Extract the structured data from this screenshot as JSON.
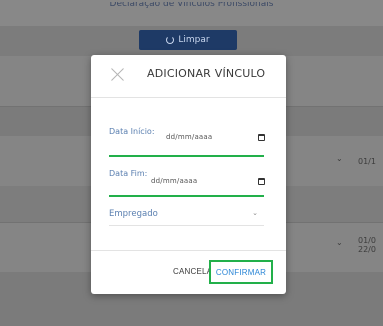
{
  "background": {
    "heading": "Declaração de Vínculos Profissionais",
    "limpar_button": "Limpar",
    "row1_date": "01/1",
    "row2_date_a": "01/0",
    "row2_date_b": "22/0"
  },
  "modal": {
    "title": "ADICIONAR VÍNCULO",
    "data_inicio": {
      "label": "Data Início:",
      "placeholder": "dd/mm/aaaa"
    },
    "data_fim": {
      "label": "Data Fim:",
      "placeholder": "dd/mm/aaaa"
    },
    "tipo_select": {
      "value": "Empregado"
    },
    "cancel_label": "CANCELAR",
    "confirm_label": "CONFIRMAR"
  },
  "colors": {
    "overlay": "#7f7f7f",
    "modal_bg": "#ffffff",
    "accent_green": "#22b04a",
    "label_blue": "#5a7fb0",
    "confirm_blue": "#2b86d6",
    "limpar_bg": "#1e3a66"
  },
  "icons": [
    "close-icon",
    "calendar-icon",
    "chevron-down-icon",
    "refresh-icon"
  ]
}
